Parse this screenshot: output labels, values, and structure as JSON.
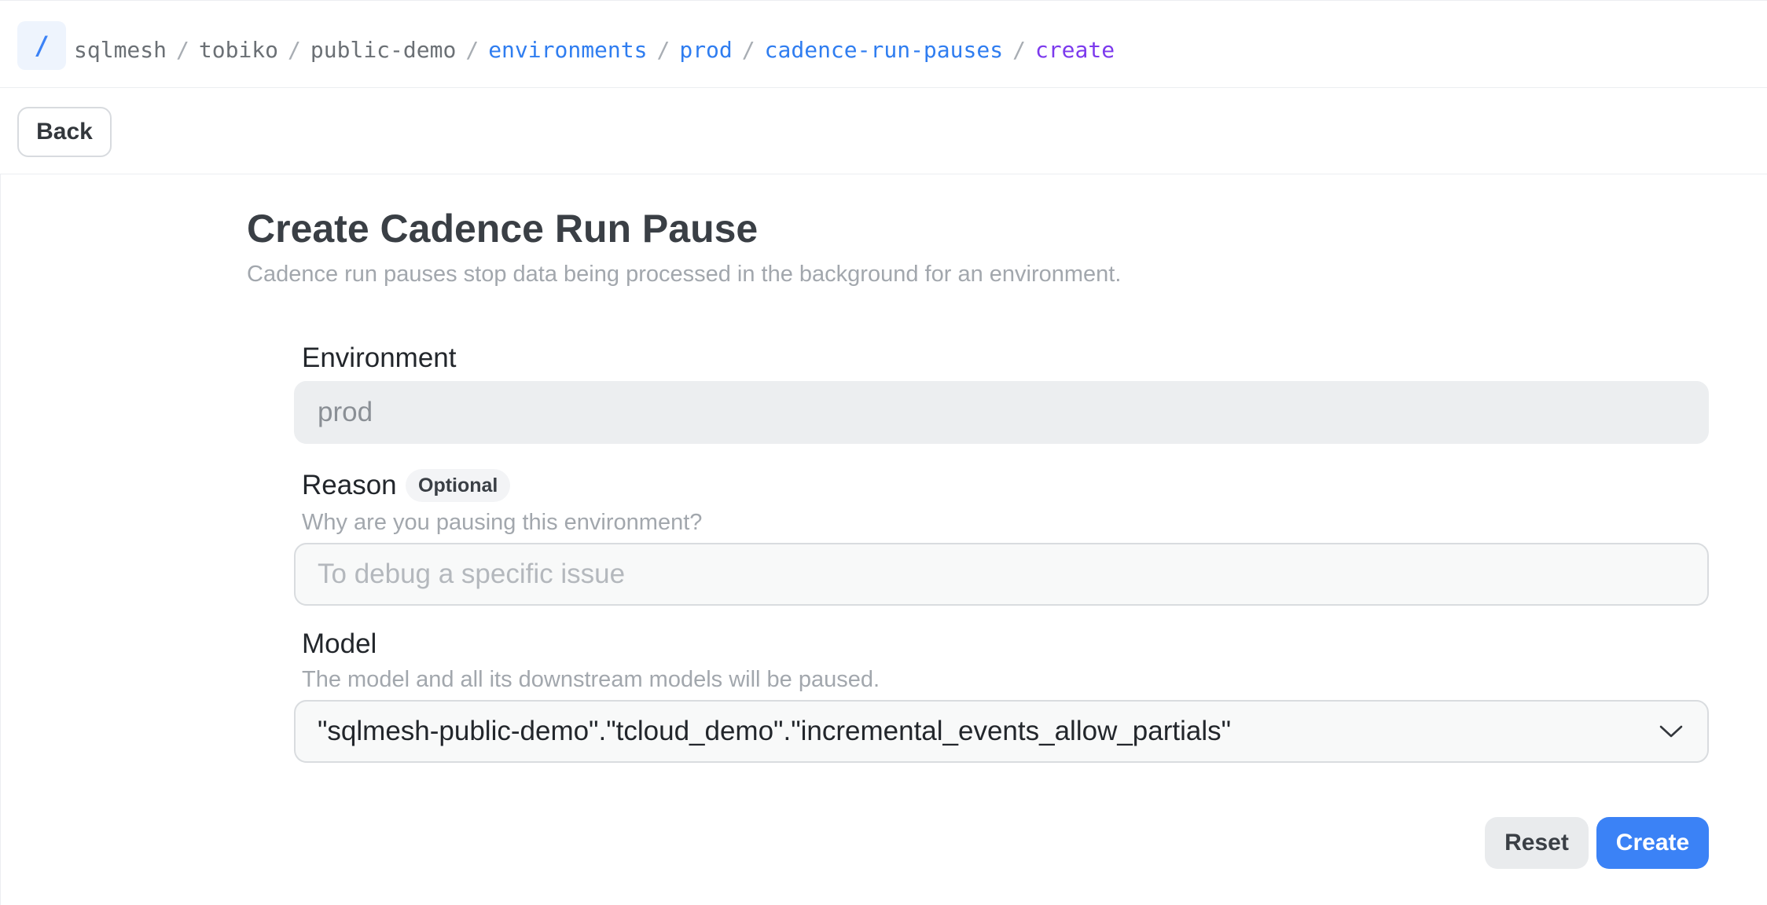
{
  "topbar": {
    "root_glyph": "/",
    "breadcrumbs": [
      {
        "label": "sqlmesh",
        "style": "muted"
      },
      {
        "label": "tobiko",
        "style": "muted"
      },
      {
        "label": "public-demo",
        "style": "muted"
      },
      {
        "label": "environments",
        "style": "link"
      },
      {
        "label": "prod",
        "style": "link"
      },
      {
        "label": "cadence-run-pauses",
        "style": "link"
      },
      {
        "label": "create",
        "style": "current"
      }
    ],
    "separator": "/"
  },
  "toolbar": {
    "back_label": "Back"
  },
  "page": {
    "title": "Create Cadence Run Pause",
    "subtitle": "Cadence run pauses stop data being processed in the background for an environment."
  },
  "form": {
    "environment": {
      "label": "Environment",
      "value": "prod"
    },
    "reason": {
      "label": "Reason",
      "badge": "Optional",
      "help": "Why are you pausing this environment?",
      "placeholder": "To debug a specific issue",
      "value": ""
    },
    "model": {
      "label": "Model",
      "help": "The model and all its downstream models will be paused.",
      "selected": "\"sqlmesh-public-demo\".\"tcloud_demo\".\"incremental_events_allow_partials\"",
      "icon": "chevron-down-icon"
    },
    "actions": {
      "reset_label": "Reset",
      "create_label": "Create"
    }
  },
  "colors": {
    "accent": "#3b82f6",
    "link": "#2f7df0",
    "current_crumb": "#7c3aed",
    "muted_text": "#a2a7ad"
  }
}
